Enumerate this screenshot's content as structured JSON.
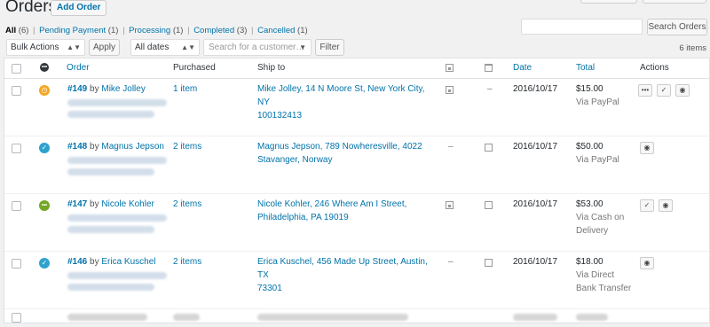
{
  "header": {
    "title": "Orders",
    "add_order_label": "Add Order"
  },
  "filters": {
    "all": {
      "label": "All",
      "count": "(6)"
    },
    "pending": {
      "label": "Pending Payment",
      "count": "(1)"
    },
    "processing": {
      "label": "Processing",
      "count": "(1)"
    },
    "completed": {
      "label": "Completed",
      "count": "(3)"
    },
    "cancelled": {
      "label": "Cancelled",
      "count": "(1)"
    },
    "separator": "|"
  },
  "search": {
    "button_label": "Search Orders"
  },
  "toolbar": {
    "bulk_actions": "Bulk Actions",
    "apply_label": "Apply",
    "dates_label": "All dates",
    "customer_placeholder": "Search for a customer…",
    "filter_label": "Filter",
    "items_count": "6 items"
  },
  "table": {
    "columns": {
      "order": "Order",
      "purchased": "Purchased",
      "ship_to": "Ship to",
      "date": "Date",
      "total": "Total",
      "actions": "Actions"
    },
    "rows": [
      {
        "status_color": "#f5a623",
        "status_glyph": "◷",
        "order_no": "#149",
        "by": "by",
        "customer": "Mike Jolley",
        "purchased": "1 item",
        "ship_to_line1": "Mike Jolley, 14 N Moore St, New York City, NY",
        "ship_to_line2": "100132413",
        "billing_mark": "–",
        "date": "2016/10/17",
        "total": "$15.00",
        "via_line1": "Via PayPal",
        "via_line2": "",
        "actions": [
          "•••",
          "✓",
          "◉"
        ]
      },
      {
        "status_color": "#2ea2cc",
        "status_glyph": "✓",
        "order_no": "#148",
        "by": "by",
        "customer": "Magnus Jepson",
        "purchased": "2 items",
        "ship_to_line1": "Magnus Jepson, 789 Nowheresville, 4022",
        "ship_to_line2": "Stavanger, Norway",
        "billing_mark": "–",
        "date": "2016/10/17",
        "total": "$50.00",
        "via_line1": "Via PayPal",
        "via_line2": "",
        "actions": [
          "◉"
        ]
      },
      {
        "status_color": "#73a724",
        "status_glyph": "•••",
        "order_no": "#147",
        "by": "by",
        "customer": "Nicole Kohler",
        "purchased": "2 items",
        "ship_to_line1": "Nicole Kohler, 246 Where Am I Street,",
        "ship_to_line2": "Philadelphia, PA 19019",
        "billing_mark": "",
        "date": "2016/10/17",
        "total": "$53.00",
        "via_line1": "Via Cash on",
        "via_line2": "Delivery",
        "actions": [
          "✓",
          "◉"
        ]
      },
      {
        "status_color": "#2ea2cc",
        "status_glyph": "✓",
        "order_no": "#146",
        "by": "by",
        "customer": "Erica Kuschel",
        "purchased": "2 items",
        "ship_to_line1": "Erica Kuschel, 456 Made Up Street, Austin, TX",
        "ship_to_line2": "73301",
        "billing_mark": "–",
        "date": "2016/10/17",
        "total": "$18.00",
        "via_line1": "Via Direct",
        "via_line2": "Bank Transfer",
        "actions": [
          "◉"
        ]
      }
    ]
  }
}
